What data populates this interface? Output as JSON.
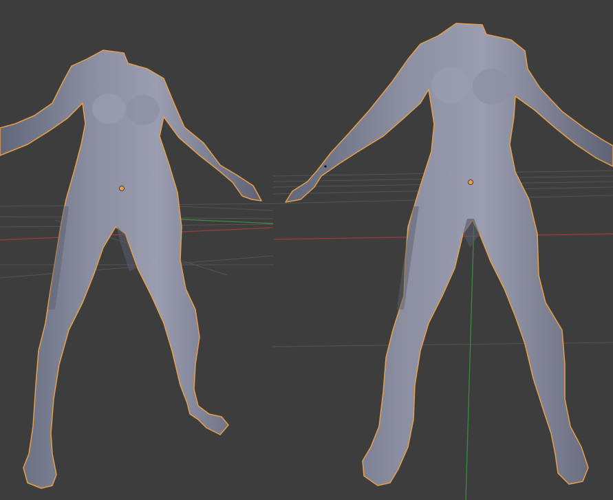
{
  "workspace": {
    "background_color": "#3d3d3d",
    "viewports": [
      {
        "view": "perspective",
        "object": "body-mesh",
        "selected": true
      },
      {
        "view": "perspective",
        "object": "body-mesh",
        "selected": true
      }
    ]
  },
  "colors": {
    "mesh_fill": "#7b7f8e",
    "mesh_highlight": "#9a9eae",
    "mesh_shadow": "#5c5f6c",
    "selection_outline": "#e8a04a",
    "origin_dot": "#f0a040",
    "grid_line": "#555555",
    "axis_x": "#a33a3a",
    "axis_y": "#3f8f3f"
  },
  "icons": {
    "origin": "object-origin-icon",
    "grid": "floor-grid",
    "axes": "xy-axis-lines"
  }
}
